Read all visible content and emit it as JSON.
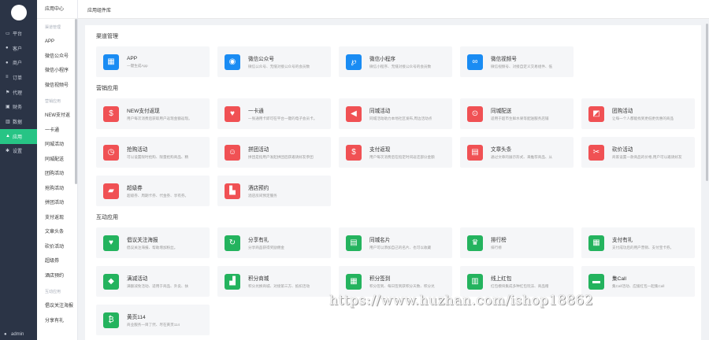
{
  "nav": {
    "items": [
      {
        "icon": "monitor-icon",
        "glyph": "▭",
        "label": "平台"
      },
      {
        "icon": "user-icon",
        "glyph": "●",
        "label": "客户"
      },
      {
        "icon": "users-icon",
        "glyph": "●",
        "label": "商户"
      },
      {
        "icon": "list-icon",
        "glyph": "≡",
        "label": "订单"
      },
      {
        "icon": "flag-icon",
        "glyph": "⚑",
        "label": "代理"
      },
      {
        "icon": "finance-icon",
        "glyph": "▣",
        "label": "财务"
      },
      {
        "icon": "chart-icon",
        "glyph": "▥",
        "label": "数据"
      },
      {
        "icon": "apps-icon",
        "glyph": "▲",
        "label": "应用"
      },
      {
        "icon": "gear-icon",
        "glyph": "✱",
        "label": "设置"
      }
    ],
    "user": "admin"
  },
  "sidebar": {
    "title": "应用中心",
    "groups": [
      {
        "title": "渠道管理",
        "items": [
          "APP",
          "微信公众号",
          "微信小程序",
          "微信视频号"
        ]
      },
      {
        "title": "营销应用",
        "items": [
          "NEW支付返",
          "一卡通",
          "同城活动",
          "同城配送",
          "团购活动",
          "抢购活动",
          "拼团活动",
          "支付返现",
          "文章头条",
          "砍价活动",
          "超级券",
          "酒店预约"
        ]
      },
      {
        "title": "互动应用",
        "items": [
          "倡议关注海报",
          "分享有礼"
        ]
      }
    ]
  },
  "header": {
    "breadcrumb": "应用组件库"
  },
  "sections": [
    {
      "title": "渠道管理",
      "cards": [
        {
          "name": "APP",
          "desc": "一键生成App",
          "color": "blue",
          "icon": "apps-grid-icon",
          "glyph": "▦"
        },
        {
          "name": "微信公众号",
          "desc": "微信公众号、无缝对接公众号的会员数",
          "color": "blue",
          "icon": "wechat-icon",
          "glyph": "◉"
        },
        {
          "name": "微信小程序",
          "desc": "微信小程序、无缝对接公众号的会员数",
          "color": "blue",
          "icon": "mini-program-icon",
          "glyph": "℘"
        },
        {
          "name": "微信视频号",
          "desc": "微信视频号、对接自定义交易组件、低",
          "color": "blue",
          "icon": "video-channel-icon",
          "glyph": "∞"
        }
      ]
    },
    {
      "title": "营销应用",
      "cards": [
        {
          "name": "NEW支付返现",
          "desc": "用户每次消费后获取用户返现金额返现。",
          "color": "red",
          "icon": "money-bag-icon",
          "glyph": "$"
        },
        {
          "name": "一卡通",
          "desc": "一张通用卡即可在平台一键的电子会员卡。",
          "color": "red",
          "icon": "heart-icon",
          "glyph": "♥"
        },
        {
          "name": "同城活动",
          "desc": "同城活动助力本地社区发布,周边活动点",
          "color": "red",
          "icon": "megaphone-icon",
          "glyph": "◀"
        },
        {
          "name": "同城配送",
          "desc": "适用于超市生鲜水果等配送服务店铺",
          "color": "red",
          "icon": "scooter-icon",
          "glyph": "⊙"
        },
        {
          "name": "团购活动",
          "desc": "让每一个人都能找到更低更优惠的商品",
          "color": "red",
          "icon": "group-buy-icon",
          "glyph": "◩"
        },
        {
          "name": "抢购活动",
          "desc": "可以设置限时抢购、限量抢购商品、精",
          "color": "red",
          "icon": "clock-icon",
          "glyph": "◷"
        },
        {
          "name": "拼团活动",
          "desc": "拼团是指用户发起拼团后获邀请好友参团",
          "color": "red",
          "icon": "pin-group-icon",
          "glyph": "☺"
        },
        {
          "name": "支付返现",
          "desc": "用户每次消费后在指定时间返还部分金额",
          "color": "red",
          "icon": "cashback-icon",
          "glyph": "$"
        },
        {
          "name": "文章头条",
          "desc": "通过文章的展示形式、来推荐商品、从",
          "color": "red",
          "icon": "article-icon",
          "glyph": "▤"
        },
        {
          "name": "砍价活动",
          "desc": "商家设置一款商品的价格,用户可以邀请好友",
          "color": "red",
          "icon": "bargain-icon",
          "glyph": "✂"
        },
        {
          "name": "超级券",
          "desc": "超级券、周期卡券、代金券、享有券。",
          "color": "red",
          "icon": "ticket-icon",
          "glyph": "▰"
        },
        {
          "name": "酒店预约",
          "desc": "酒店房间预定服务",
          "color": "red",
          "icon": "hotel-icon",
          "glyph": "▙"
        }
      ]
    },
    {
      "title": "互动应用",
      "cards": [
        {
          "name": "倡议关注海报",
          "desc": "倡议关注海报、帮助增加粉丝。",
          "color": "green",
          "icon": "heart-icon",
          "glyph": "♥"
        },
        {
          "name": "分享有礼",
          "desc": "分享商品获得奖励佣金",
          "color": "green",
          "icon": "share-icon",
          "glyph": "↻"
        },
        {
          "name": "同城名片",
          "desc": "用户可以添加自己的名片、也可以收藏",
          "color": "green",
          "icon": "card-icon",
          "glyph": "▤"
        },
        {
          "name": "排行榜",
          "desc": "排行榜",
          "color": "green",
          "icon": "trophy-icon",
          "glyph": "♛"
        },
        {
          "name": "支付有礼",
          "desc": "支付成功后的用户营销、支付宝卡券。",
          "color": "green",
          "icon": "gift-icon",
          "glyph": "▦"
        },
        {
          "name": "满减活动",
          "desc": "满额减免活动、适用于商品、外卖、扶",
          "color": "green",
          "icon": "tag-icon",
          "glyph": "◆"
        },
        {
          "name": "积分商城",
          "desc": "积分兑换商城、对接第三方、抵扣活动",
          "color": "green",
          "icon": "shop-icon",
          "glyph": "▟"
        },
        {
          "name": "积分签到",
          "desc": "积分签到、每日签到获积分天数、积分兑",
          "color": "green",
          "icon": "calendar-icon",
          "glyph": "▦"
        },
        {
          "name": "线上红包",
          "desc": "红包模块集成多种红包玩法、商品赠",
          "color": "green",
          "icon": "red-packet-icon",
          "glyph": "▥"
        },
        {
          "name": "集Call",
          "desc": "集Call活动、应援红包一起集Call",
          "color": "green",
          "icon": "call-icon",
          "glyph": "▬"
        },
        {
          "name": "黄页114",
          "desc": "商业服务一目了然、尽在黄页114",
          "color": "green",
          "icon": "yellow-pages-icon",
          "glyph": "₿"
        }
      ]
    }
  ],
  "watermark": "https://www.huzhan.com/ishop18862"
}
